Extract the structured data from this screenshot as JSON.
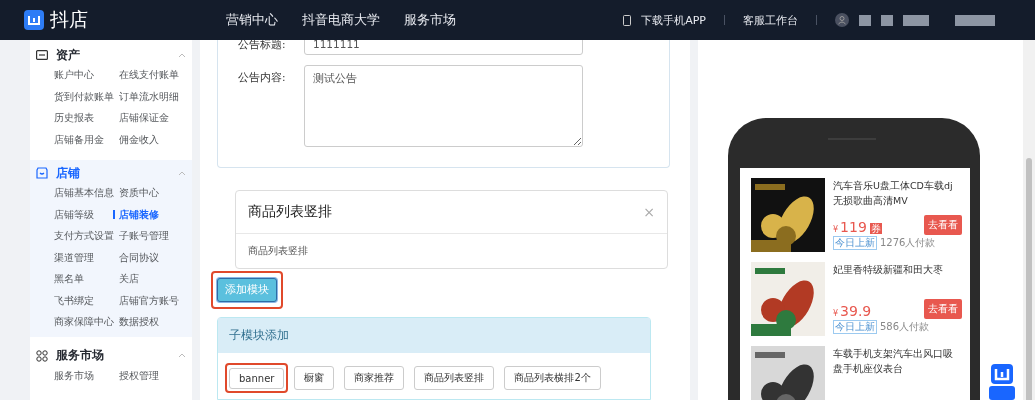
{
  "header": {
    "brand": "抖店",
    "nav": [
      "营销中心",
      "抖音电商大学",
      "服务市场"
    ],
    "app_link": "下载手机APP",
    "workbench": "客服工作台"
  },
  "sidebar": [
    {
      "title": "资产",
      "selected": false,
      "items": [
        {
          "label": "账户中心",
          "selected": false
        },
        {
          "label": "在线支付账单",
          "selected": false
        },
        {
          "label": "货到付款账单",
          "selected": false
        },
        {
          "label": "订单流水明细",
          "selected": false
        },
        {
          "label": "历史报表",
          "selected": false
        },
        {
          "label": "店铺保证金",
          "selected": false
        },
        {
          "label": "店铺备用金",
          "selected": false
        },
        {
          "label": "佣金收入",
          "selected": false
        }
      ]
    },
    {
      "title": "店铺",
      "selected": true,
      "items": [
        {
          "label": "店铺基本信息",
          "selected": false
        },
        {
          "label": "资质中心",
          "selected": false
        },
        {
          "label": "店铺等级",
          "selected": false
        },
        {
          "label": "店铺装修",
          "selected": true
        },
        {
          "label": "支付方式设置",
          "selected": false
        },
        {
          "label": "子账号管理",
          "selected": false
        },
        {
          "label": "渠道管理",
          "selected": false
        },
        {
          "label": "合同协议",
          "selected": false
        },
        {
          "label": "黑名单",
          "selected": false
        },
        {
          "label": "关店",
          "selected": false
        },
        {
          "label": "飞书绑定",
          "selected": false
        },
        {
          "label": "店铺官方账号",
          "selected": false
        },
        {
          "label": "商家保障中心",
          "selected": false
        },
        {
          "label": "数据授权",
          "selected": false
        }
      ]
    },
    {
      "title": "服务市场",
      "selected": false,
      "items": [
        {
          "label": "服务市场",
          "selected": false
        },
        {
          "label": "授权管理",
          "selected": false
        }
      ]
    }
  ],
  "form": {
    "fields": [
      {
        "kind": "input",
        "label": "公告标题:",
        "value": "1111111"
      },
      {
        "kind": "textarea",
        "label": "公告内容:",
        "value": "测试公告"
      }
    ]
  },
  "module_card": {
    "title": "商品列表竖排",
    "close": "×",
    "body": "商品列表竖排"
  },
  "add_module_button": {
    "label": "添加模块",
    "highlighted": true
  },
  "submodule_panel": {
    "title": "子模块添加",
    "buttons": [
      {
        "label": "banner",
        "highlighted": true
      },
      {
        "label": "橱窗",
        "highlighted": false
      },
      {
        "label": "商家推荐",
        "highlighted": false
      },
      {
        "label": "商品列表竖排",
        "highlighted": false
      },
      {
        "label": "商品列表横排2个",
        "highlighted": false
      }
    ]
  },
  "preview_products": [
    {
      "title": "汽车音乐U盘工体CD车载dj无损歌曲高清MV",
      "currency": "¥",
      "price": "119",
      "coupon": "券",
      "tag": "今日上新",
      "sales": "1276人付款",
      "action": "去看看"
    },
    {
      "title": "妃里香特级新疆和田大枣",
      "currency": "¥",
      "price": "39.9",
      "tag": "今日上新",
      "sales": "586人付款",
      "action": "去看看"
    },
    {
      "title": "车载手机支架汽车出风口吸盘手机座仪表台"
    }
  ]
}
